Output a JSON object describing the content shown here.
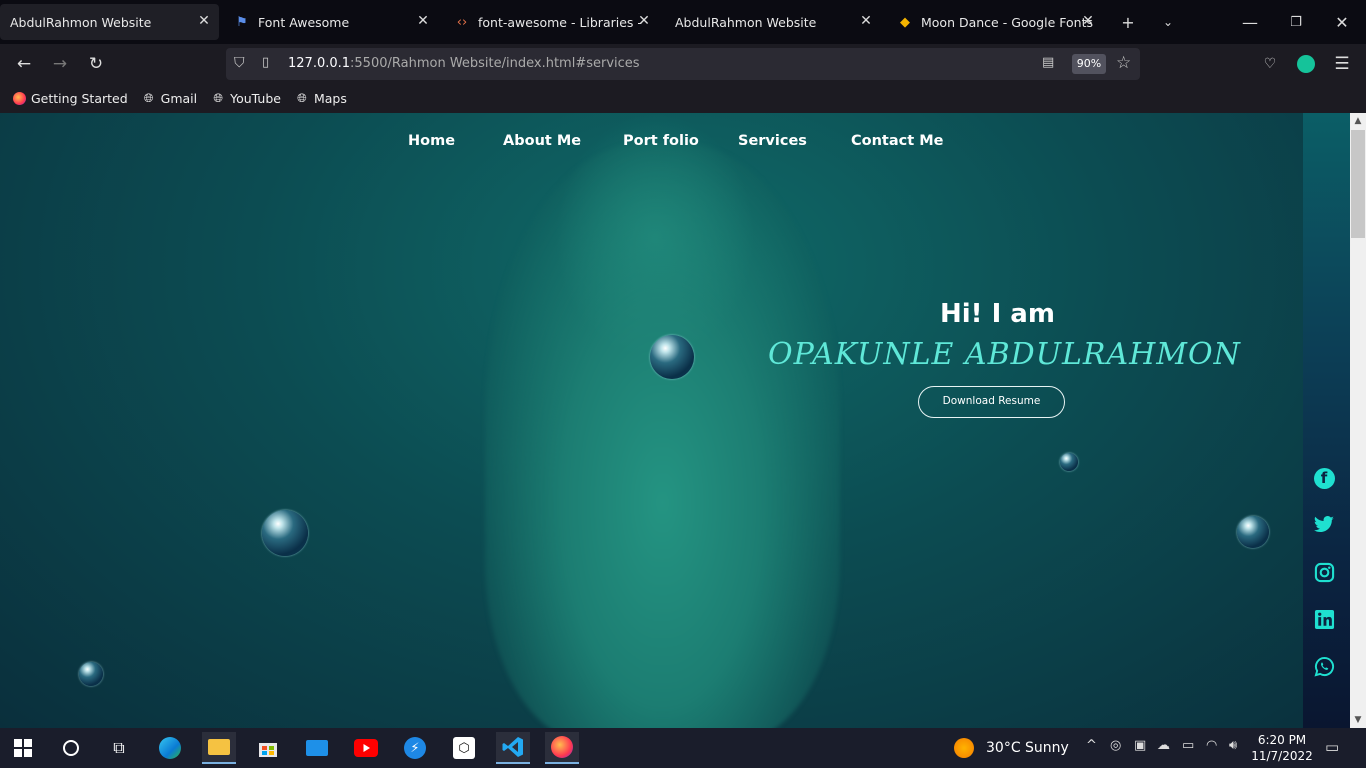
{
  "browser": {
    "tabs": [
      {
        "label": "AbdulRahmon Website",
        "icon": "page-icon",
        "active": true
      },
      {
        "label": "Font Awesome",
        "icon": "flag-icon",
        "active": false
      },
      {
        "label": "font-awesome - Libraries - cdnjs",
        "icon": "code-icon",
        "active": false
      },
      {
        "label": "AbdulRahmon Website",
        "icon": "page-icon",
        "active": false
      },
      {
        "label": "Moon Dance - Google Fonts",
        "icon": "google-fonts-icon",
        "active": false
      }
    ],
    "url_host": "127.0.0.1",
    "url_rest": ":5500/Rahmon Website/index.html#services",
    "zoom": "90%",
    "bookmarks": [
      {
        "label": "Getting Started",
        "icon": "firefox-icon"
      },
      {
        "label": "Gmail",
        "icon": "globe-icon"
      },
      {
        "label": "YouTube",
        "icon": "globe-icon"
      },
      {
        "label": "Maps",
        "icon": "globe-icon"
      }
    ]
  },
  "site": {
    "menu": [
      "Home",
      "About Me",
      "Port folio",
      "Services",
      "Contact Me"
    ],
    "greeting": "Hi! I am",
    "name": "OPAKUNLE ABDULRAHMON",
    "resume_button": "Download Resume",
    "social": [
      "facebook-icon",
      "twitter-icon",
      "instagram-icon",
      "linkedin-icon",
      "whatsapp-icon"
    ],
    "accent_color": "#5fe8d8"
  },
  "taskbar": {
    "weather": "30°C  Sunny",
    "time": "6:20 PM",
    "date": "11/7/2022"
  }
}
